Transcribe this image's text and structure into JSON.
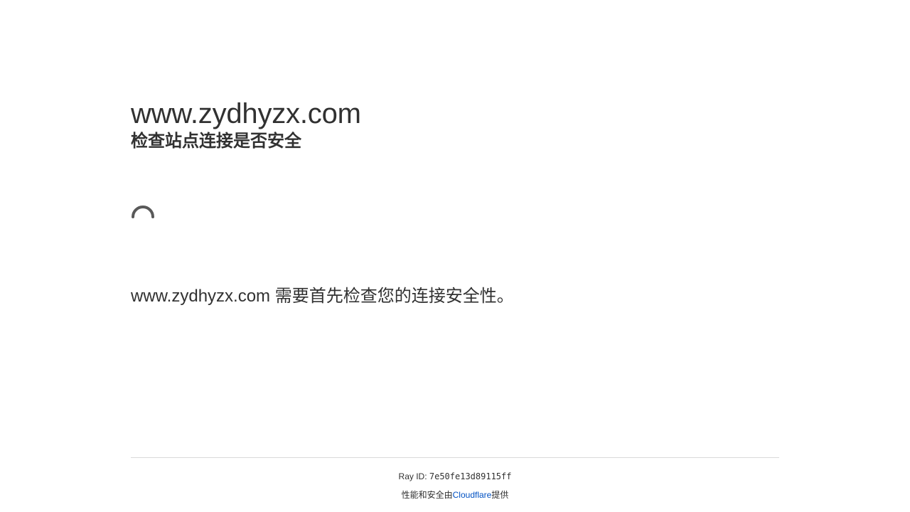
{
  "header": {
    "site_title": "www.zydhyzx.com",
    "subtitle": "检查站点连接是否安全"
  },
  "main": {
    "spinner_icon": "loading-spinner-icon",
    "message": "www.zydhyzx.com 需要首先检查您的连接安全性。"
  },
  "footer": {
    "ray_label": "Ray ID: ",
    "ray_id": "7e50fe13d89115ff",
    "powered_prefix": "性能和安全由",
    "provider_link": "Cloudflare",
    "powered_suffix": "提供"
  },
  "colors": {
    "text": "#313131",
    "link": "#0051c3",
    "divider": "#d9d9d9",
    "background": "#ffffff"
  }
}
